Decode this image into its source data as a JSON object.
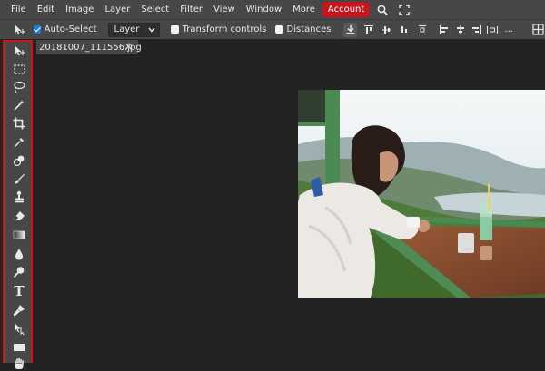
{
  "menu": {
    "items": [
      "File",
      "Edit",
      "Image",
      "Layer",
      "Select",
      "Filter",
      "View",
      "Window",
      "More"
    ],
    "account_label": "Account",
    "search_icon": "search-icon",
    "fullscreen_icon": "fullscreen-icon"
  },
  "options": {
    "auto_select_label": "Auto-Select",
    "auto_select_checked": true,
    "layer_select_value": "Layer",
    "transform_controls_label": "Transform controls",
    "transform_controls_checked": false,
    "distances_label": "Distances",
    "distances_checked": false,
    "more_label": "..."
  },
  "document": {
    "tab_label": "20181007_111556.jpg",
    "close_label": "✕"
  },
  "toolbox": {
    "tools": [
      "move-tool",
      "marquee-tool",
      "lasso-tool",
      "magic-wand-tool",
      "crop-tool",
      "eyedropper-tool",
      "healing-brush-tool",
      "brush-tool",
      "clone-stamp-tool",
      "eraser-tool",
      "gradient-tool",
      "blur-tool",
      "dodge-tool",
      "type-tool",
      "pen-tool",
      "path-select-tool",
      "rectangle-tool",
      "hand-tool"
    ],
    "type_tool_glyph": "T",
    "highlight_color": "#d01515"
  },
  "colors": {
    "background": "#232323",
    "panel": "#474747",
    "account": "#c8141b",
    "checkbox_accent": "#1b7ee0"
  }
}
